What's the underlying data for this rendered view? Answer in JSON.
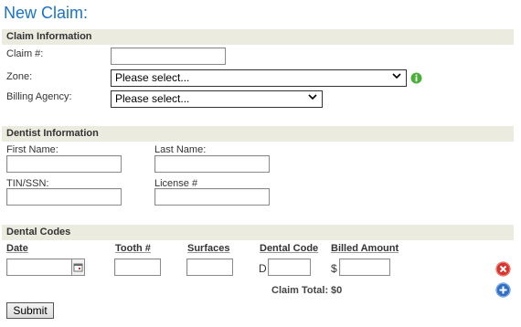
{
  "page": {
    "title": "New Claim:"
  },
  "claim_info": {
    "header": "Claim Information",
    "claim_label": "Claim #:",
    "claim_value": "",
    "zone_label": "Zone:",
    "zone_selected": "Please select...",
    "billing_label": "Billing Agency:",
    "billing_selected": "Please select..."
  },
  "dentist_info": {
    "header": "Dentist Information",
    "first_name_label": "First Name:",
    "last_name_label": "Last Name:",
    "tin_label": "TIN/SSN:",
    "license_label": "License #"
  },
  "dental_codes": {
    "header": "Dental Codes",
    "columns": [
      "Date",
      "Tooth #",
      "Surfaces",
      "Dental Code",
      "Billed Amount"
    ],
    "code_prefix": "D",
    "amount_prefix": "$",
    "claim_total_label": "Claim Total:",
    "claim_total_value": "$0"
  },
  "actions": {
    "submit_label": "Submit"
  },
  "colors": {
    "title": "#1a73c8",
    "section_bar": "#ebebe0",
    "remove_icon": "#d9342b",
    "add_icon": "#2f6fc6",
    "info_icon": "#4caf3c"
  }
}
